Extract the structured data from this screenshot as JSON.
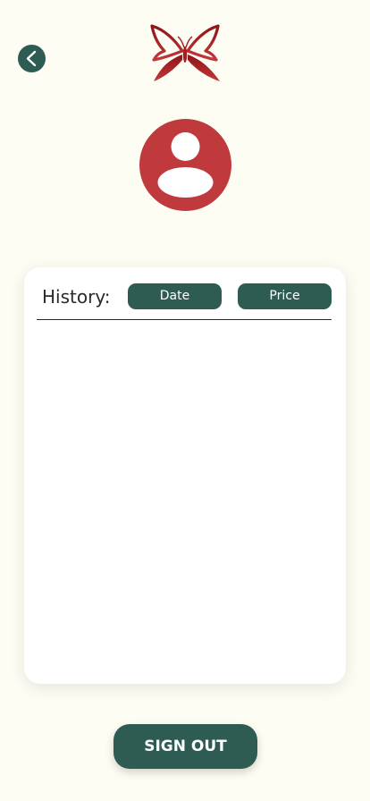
{
  "header": {
    "back_icon": "chevron-left-icon",
    "logo_icon": "butterfly-logo-icon"
  },
  "profile": {
    "avatar_icon": "user-avatar-icon"
  },
  "history": {
    "label": "History:",
    "sort_buttons": [
      {
        "label": "Date"
      },
      {
        "label": "Price"
      }
    ],
    "items": []
  },
  "footer": {
    "signout_label": "SIGN OUT"
  },
  "colors": {
    "background": "#FDFDF3",
    "primary_green": "#2E5B52",
    "accent_red": "#C0393D",
    "logo_red": "#A51E22",
    "card": "#FFFFFF"
  }
}
